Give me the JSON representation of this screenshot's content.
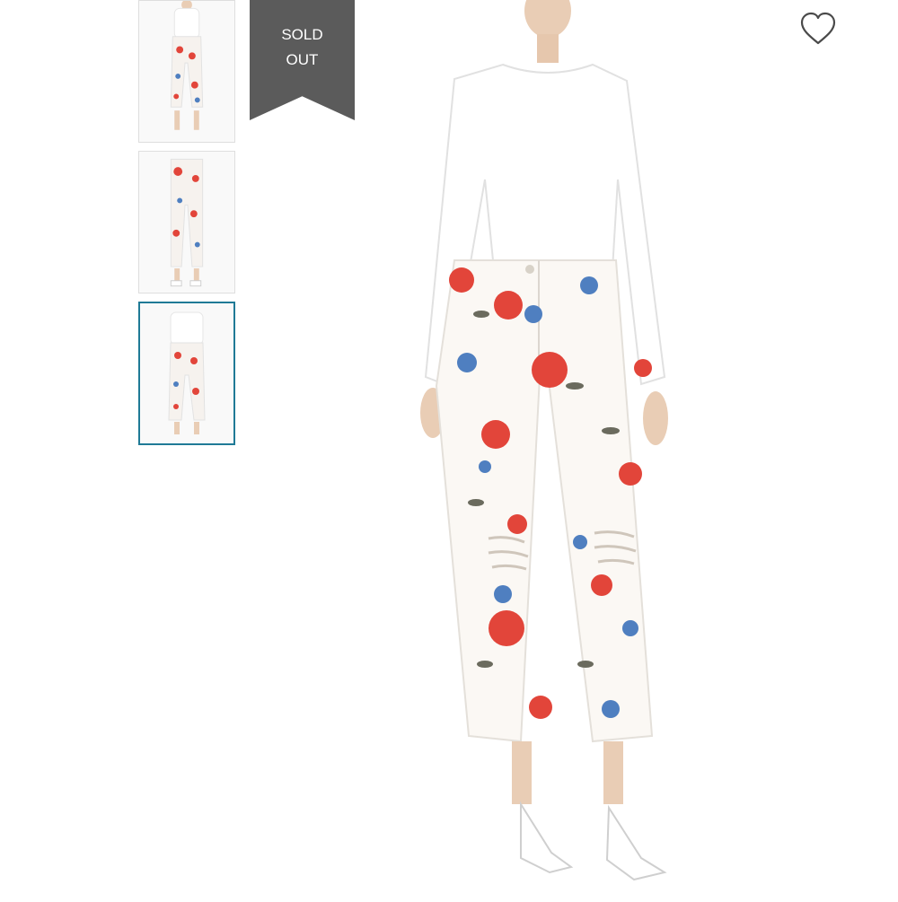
{
  "gallery": {
    "thumbnails": [
      {
        "view": "front-full"
      },
      {
        "view": "back-full"
      },
      {
        "view": "front-cropped",
        "selected": true
      }
    ]
  },
  "badge": {
    "line1": "SOLD",
    "line2": "OUT"
  },
  "wishlist": {
    "icon": "heart-outline-icon"
  },
  "colors": {
    "badge_bg": "#5b5b5b",
    "selected_border": "#1f7a96",
    "floral_red": "#e2453a",
    "floral_blue": "#4f7fc0"
  }
}
